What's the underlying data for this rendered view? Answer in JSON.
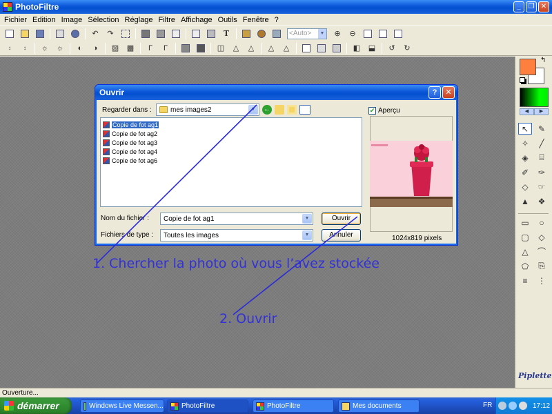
{
  "window": {
    "title": "PhotoFiltre"
  },
  "menu": [
    "Fichier",
    "Edition",
    "Image",
    "Sélection",
    "Réglage",
    "Filtre",
    "Affichage",
    "Outils",
    "Fenêtre",
    "?"
  ],
  "toolbar": {
    "zoom_combo": "<Auto>"
  },
  "dialog": {
    "title": "Ouvrir",
    "look_in_label": "Regarder dans :",
    "look_in_value": "mes images2",
    "files": [
      "Copie de fot ag1",
      "Copie de fot ag2",
      "Copie de fot ag3",
      "Copie de fot ag4",
      "Copie de fot ag6"
    ],
    "selected_file_index": 0,
    "filename_label": "Nom du fichier :",
    "filename_value": "Copie de fot ag1",
    "filetype_label": "Fichiers de type :",
    "filetype_value": "Toutes les images",
    "open_button": "Ouvrir",
    "cancel_button": "Annuler",
    "preview_label": "Aperçu",
    "preview_checked": true,
    "preview_size": "1024x819 pixels"
  },
  "annotations": {
    "step1": "1. Chercher la photo où vous l’avez stockée",
    "step2": "2. Ouvrir"
  },
  "signature": "Piplette",
  "status": "Ouverture...",
  "taskbar": {
    "start": "démarrer",
    "tasks": [
      "Windows Live Messen...",
      "PhotoFiltre",
      "PhotoFiltre",
      "Mes documents"
    ],
    "lang": "FR",
    "clock": "17:12"
  },
  "colors": {
    "foreground": "#ff7f3f",
    "background": "#ffffff",
    "annotation": "#3232d6"
  }
}
